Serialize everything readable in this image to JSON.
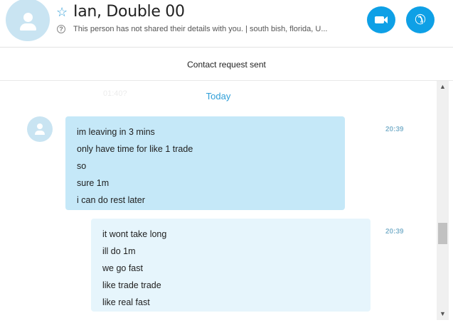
{
  "header": {
    "contact_name": "Ian, Double 00",
    "contact_details": "This person has not shared their details with you.  |  south bish, florida, U...",
    "star_icon": "star-outline-icon",
    "help_icon": "question-circle-icon",
    "video_call_icon": "video-camera-icon",
    "audio_call_icon": "phone-icon",
    "accent_color": "#0ea0e6"
  },
  "request_bar": {
    "text": "Contact request sent"
  },
  "chat": {
    "previous_time": "01:40?",
    "day_label": "Today",
    "messages": [
      {
        "direction": "incoming",
        "time": "20:39",
        "lines": [
          "im leaving in 3 mins",
          "only have time for like 1 trade",
          "so",
          "sure 1m",
          "i can do rest later"
        ]
      },
      {
        "direction": "outgoing",
        "time": "20:39",
        "lines": [
          "it wont take long",
          "ill do 1m",
          "we go fast",
          "like trade trade",
          "like real fast"
        ]
      }
    ]
  },
  "scrollbar": {
    "up_glyph": "▲",
    "down_glyph": "▼"
  }
}
